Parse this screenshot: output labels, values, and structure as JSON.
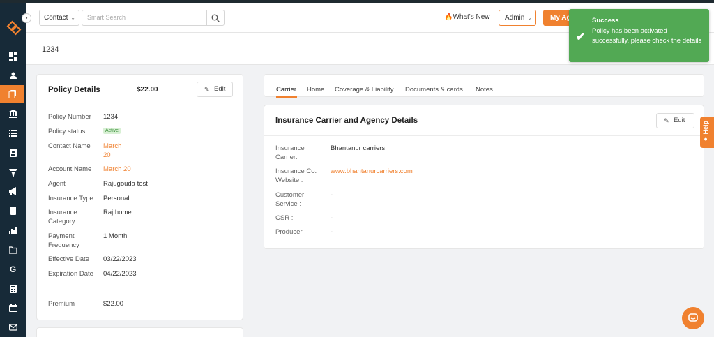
{
  "header": {
    "entity_dropdown": "Contact",
    "search_placeholder": "Smart Search",
    "whats_new": "What's New",
    "role_dropdown": "Admin",
    "my_agency_button": "My Ag"
  },
  "page": {
    "title": "1234"
  },
  "toast": {
    "title": "Success",
    "message": "Policy has been activated successfully, please check the details",
    "color": "#52a954"
  },
  "policy_details": {
    "title": "Policy Details",
    "price": "$22.00",
    "edit_label": "Edit",
    "rows": [
      {
        "label": "Policy Number",
        "value": "1234"
      },
      {
        "label": "Policy status",
        "value": "Active"
      },
      {
        "label": "Contact Name",
        "value": "March 20"
      },
      {
        "label": "Account Name",
        "value": "March 20"
      },
      {
        "label": "Agent",
        "value": "Rajugouda test"
      },
      {
        "label": "Insurance Type",
        "value": "Personal"
      },
      {
        "label": "Insurance Category",
        "value": "Raj home"
      },
      {
        "label": "Payment Frequency",
        "value": "1 Month"
      },
      {
        "label": "Effective Date",
        "value": "03/22/2023"
      },
      {
        "label": "Expiration Date",
        "value": "04/22/2023"
      }
    ],
    "premium": {
      "label": "Premium",
      "value": "$22.00"
    }
  },
  "tabs": [
    "Carrier",
    "Home",
    "Coverage & Liability",
    "Documents & cards",
    "Notes"
  ],
  "carrier_details": {
    "title": "Insurance Carrier and Agency Details",
    "edit_label": "Edit",
    "rows": [
      {
        "label": "Insurance Carrier:",
        "value": "Bhantanur carriers"
      },
      {
        "label": "Insurance Co. Website :",
        "value": "www.bhantanurcarriers.com"
      },
      {
        "label": "Customer Service :",
        "value": "-"
      },
      {
        "label": "CSR :",
        "value": "-"
      },
      {
        "label": "Producer :",
        "value": "-"
      }
    ]
  },
  "help_tab": "Help",
  "colors": {
    "accent": "#f0812f",
    "sidebar": "#172a38",
    "success": "#52a954"
  },
  "sidebar_icons": [
    "dashboard-icon",
    "contacts-icon",
    "policies-icon",
    "bank-icon",
    "list-icon",
    "id-card-icon",
    "funnel-icon",
    "megaphone-icon",
    "document-icon",
    "reports-icon",
    "folder-icon",
    "google-icon",
    "calculator-icon",
    "calendar-icon",
    "mail-icon"
  ]
}
